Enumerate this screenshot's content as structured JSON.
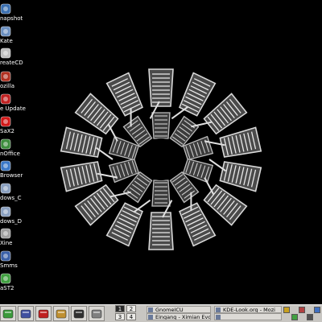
{
  "desktop": {
    "background_color": "#000000",
    "icons": [
      {
        "label": "napshot",
        "icon": "camera-icon",
        "color": "#3a6fb0"
      },
      {
        "label": "Kate",
        "icon": "text-editor-icon",
        "color": "#6a8fc0"
      },
      {
        "label": "reateCD",
        "icon": "cd-burn-icon",
        "color": "#c0c0c0"
      },
      {
        "label": "ozilla",
        "icon": "mozilla-icon",
        "color": "#b03020"
      },
      {
        "label": "e Update",
        "icon": "update-icon",
        "color": "#c02020"
      },
      {
        "label": "SaX2",
        "icon": "sax2-x-icon",
        "color": "#d01818"
      },
      {
        "label": "nOffice",
        "icon": "openoffice-icon",
        "color": "#3c8c3c"
      },
      {
        "label": "Browser",
        "icon": "globe-icon",
        "color": "#3a78c8"
      },
      {
        "label": "dows_C",
        "icon": "drive-icon",
        "color": "#8aa0c0"
      },
      {
        "label": "dows_D",
        "icon": "drive-icon",
        "color": "#8aa0c0"
      },
      {
        "label": "Xine",
        "icon": "xine-player-icon",
        "color": "#a0a0a0"
      },
      {
        "label": "Smms",
        "icon": "mobile-icon",
        "color": "#3a60a8"
      },
      {
        "label": "aST2",
        "icon": "yast-icon",
        "color": "#40a040"
      }
    ]
  },
  "panel": {
    "launchers": [
      {
        "icon": "app-menu-icon",
        "color": "#3a9a3a"
      },
      {
        "icon": "gnome-foot-icon",
        "color": "#4050a0"
      },
      {
        "icon": "lifebuoy-help-icon",
        "color": "#c02020"
      },
      {
        "icon": "home-folder-icon",
        "color": "#c09030"
      },
      {
        "icon": "terminal-icon",
        "color": "#303030"
      },
      {
        "icon": "printer-icon",
        "color": "#808080"
      }
    ],
    "workspaces": [
      "1",
      "2",
      "3",
      "4"
    ],
    "active_workspace": "1",
    "tasks": [
      {
        "label": "GnomeICU",
        "icon": "chat-icon"
      },
      {
        "label": "KDE-Look.org - Mozi",
        "icon": "mozilla-icon"
      },
      {
        "label": "Eingang - Ximian Evo",
        "icon": "mail-icon"
      },
      {
        "label": "",
        "icon": "window-icon"
      }
    ],
    "tray": [
      {
        "icon": "lock-icon"
      },
      {
        "icon": "network-icon"
      },
      {
        "icon": "tray-app-icon"
      },
      {
        "icon": "speaker-icon"
      },
      {
        "icon": "screensaver-icon"
      }
    ]
  }
}
